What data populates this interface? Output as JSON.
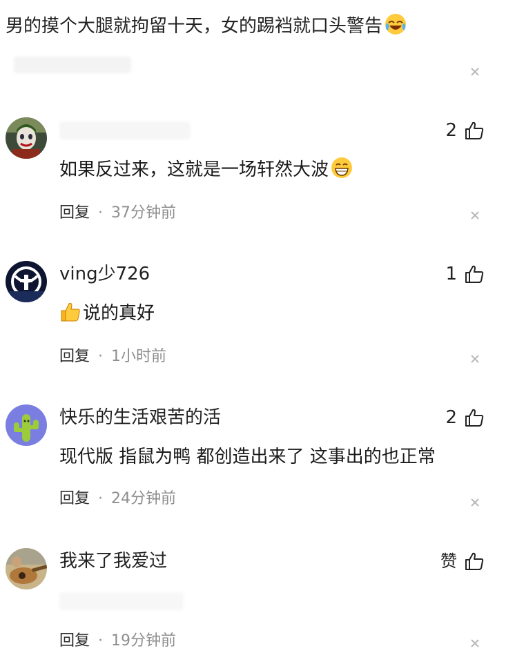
{
  "top_comment": {
    "text": "男的摸个大腿就拘留十天，女的踢裆就口头警告",
    "emoji": "laughing-crying-emoji"
  },
  "comments": [
    {
      "username": "",
      "content": "如果反过来，这就是一场轩然大波",
      "content_emoji": "grinning-emoji",
      "likes": "2",
      "reply_label": "回复",
      "separator": "·",
      "time": "37分钟前"
    },
    {
      "username": "ving少726",
      "content": "说的真好",
      "content_emoji_prefix": "thumbs-up-emoji",
      "likes": "1",
      "reply_label": "回复",
      "separator": "·",
      "time": "1小时前"
    },
    {
      "username": "快乐的生活艰苦的活",
      "content": "现代版 指鼠为鸭 都创造出来了 这事出的也正常",
      "likes": "2",
      "reply_label": "回复",
      "separator": "·",
      "time": "24分钟前"
    },
    {
      "username": "我来了我爱过",
      "content": "",
      "likes": "赞",
      "reply_label": "回复",
      "separator": "·",
      "time": "19分钟前"
    }
  ],
  "colors": {
    "meta_gray": "#8e8e8e",
    "close_gray": "#b8b8b8",
    "text": "#1a1a1a"
  }
}
